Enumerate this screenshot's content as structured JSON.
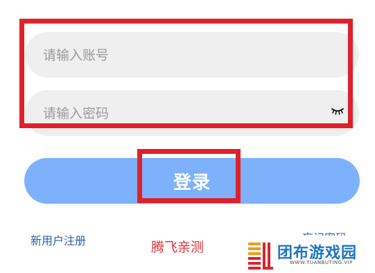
{
  "form": {
    "account": {
      "value": "",
      "placeholder": "请输入账号"
    },
    "password": {
      "value": "",
      "placeholder": "请输入密码",
      "toggle_icon": "eye-closed-icon"
    },
    "login_button": "登录"
  },
  "links": {
    "register": "新用户注册",
    "forgot_password": "忘记密码"
  },
  "overlay": {
    "watermark_text": "腾飞亲测",
    "logo_title": "团布游戏园",
    "logo_subtitle": "WWW.TUANBUTING.VIP"
  },
  "colors": {
    "input_background": "#efefef",
    "login_button": "#7db1fb",
    "link": "#2b5da6",
    "annotation_box": "#e0202a",
    "watermark": "#d6343c",
    "logo_blue": "#1a73c8",
    "logo_orange": "#f39a1e",
    "logo_red": "#d9262d"
  }
}
